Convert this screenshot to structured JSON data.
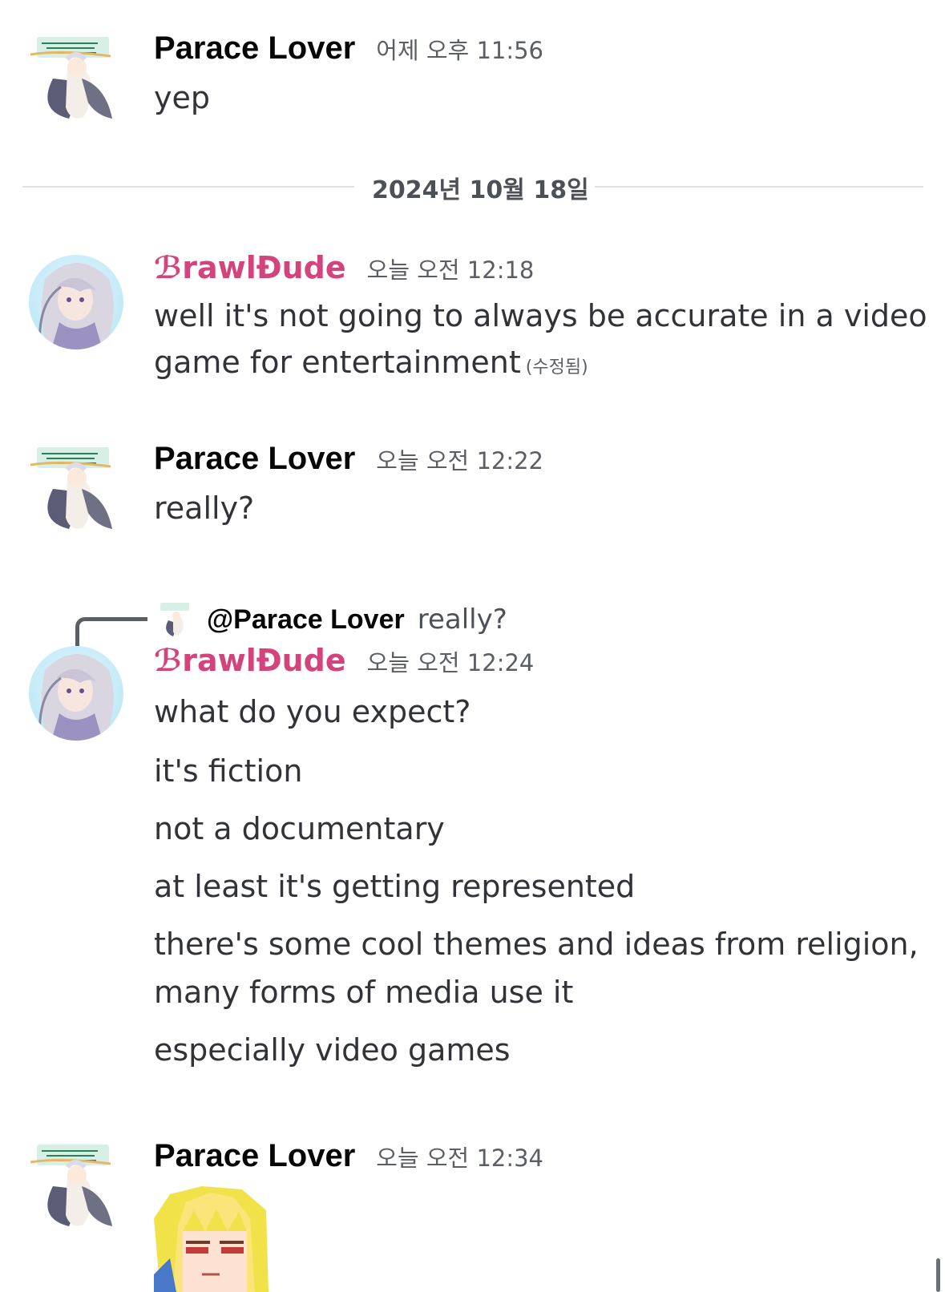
{
  "messages": [
    {
      "author": "Parace Lover",
      "timestamp": "어제 오후 11:56",
      "lines": [
        "yep"
      ]
    },
    {
      "author": "ℬrawlĐude",
      "timestamp": "오늘 오전 12:18",
      "lines": [
        "well it's not going to always be accurate in a video",
        "game for entertainment"
      ],
      "edited": "(수정됨)"
    },
    {
      "author": "Parace Lover",
      "timestamp": "오늘 오전 12:22",
      "lines": [
        "really?"
      ]
    },
    {
      "reply": {
        "mention": "@Parace Lover",
        "text": "really?"
      },
      "author": "ℬrawlĐude",
      "timestamp": "오늘 오전 12:24",
      "lines": [
        "what do you expect?",
        "it's fiction",
        "not a documentary",
        "at least it's getting represented",
        "there's some cool themes and ideas from religion,",
        "many forms of media use it",
        "especially video games"
      ]
    },
    {
      "author": "Parace Lover",
      "timestamp": "오늘 오전 12:34",
      "lines": []
    }
  ],
  "date_divider": "2024년 10월 18일",
  "colors": {
    "accent_username": "#d2447b",
    "text": "#313338",
    "muted": "#5c5e66"
  }
}
